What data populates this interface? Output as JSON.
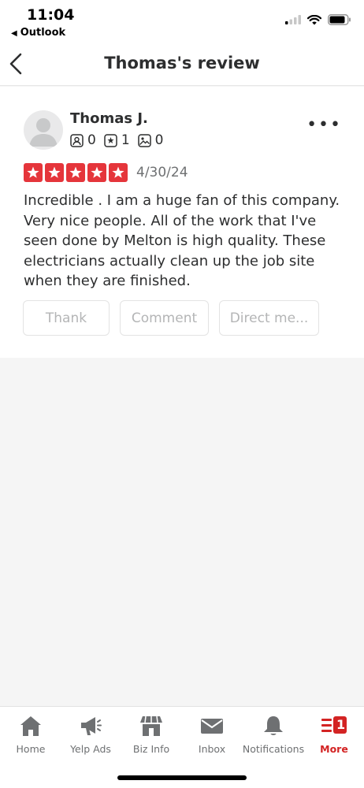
{
  "status": {
    "time": "11:04",
    "back_app": "Outlook"
  },
  "nav": {
    "title": "Thomas's review"
  },
  "review": {
    "user_name": "Thomas J.",
    "friends_count": "0",
    "reviews_count": "1",
    "photos_count": "0",
    "rating": 5,
    "date": "4/30/24",
    "text": "Incredible .  I am a huge fan of this company. Very nice people. All of the work that I've seen done by Melton is high quality. These electricians actually clean up the job site when they are finished."
  },
  "actions": {
    "thank": "Thank",
    "comment": "Comment",
    "direct_message": "Direct me..."
  },
  "tabs": [
    {
      "label": "Home",
      "icon": "home-icon"
    },
    {
      "label": "Yelp Ads",
      "icon": "megaphone-icon"
    },
    {
      "label": "Biz Info",
      "icon": "storefront-icon"
    },
    {
      "label": "Inbox",
      "icon": "envelope-icon"
    },
    {
      "label": "Notifications",
      "icon": "bell-icon"
    },
    {
      "label": "More",
      "icon": "more-menu-icon",
      "badge": "1"
    }
  ],
  "colors": {
    "brand_red": "#d32323",
    "star_red": "#e5353b"
  }
}
